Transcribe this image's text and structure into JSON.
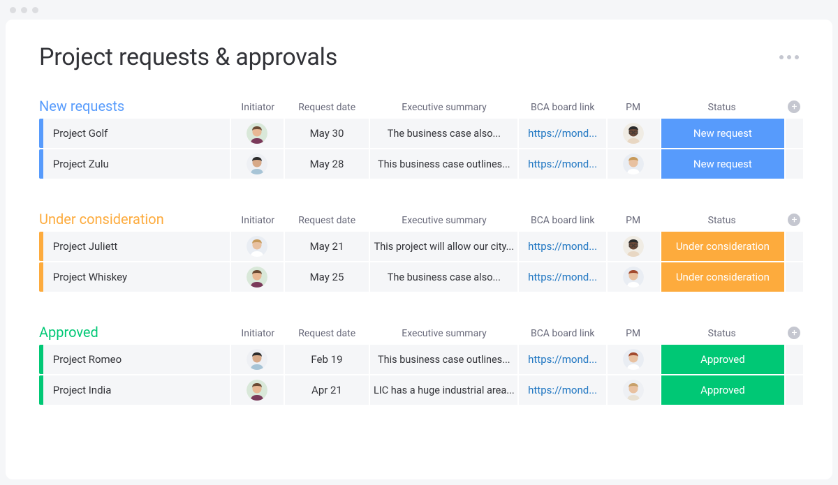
{
  "page_title": "Project requests & approvals",
  "columns": {
    "initiator": "Initiator",
    "request_date": "Request date",
    "summary": "Executive summary",
    "link": "BCA board link",
    "pm": "PM",
    "status": "Status"
  },
  "avatars": {
    "man_beard": {
      "skin": "#e8b894",
      "hair": "#6b4a33",
      "shirt": "#7a3a5a",
      "bg": "#d9e8d9"
    },
    "woman_dark": {
      "skin": "#d7a988",
      "hair": "#2b2b2b",
      "shirt": "#a7c4d6",
      "bg": "#eef0f4"
    },
    "woman_afro": {
      "skin": "#6c4a39",
      "hair": "#2b2b2b",
      "shirt": "#e8d7c3",
      "bg": "#f0ece4",
      "glasses": true
    },
    "woman_blonde": {
      "skin": "#e8c1a1",
      "hair": "#c79a5b",
      "shirt": "#ffffff",
      "bg": "#e9edf3"
    },
    "woman_red": {
      "skin": "#e8c1a1",
      "hair": "#a24a2e",
      "shirt": "#ffffff",
      "bg": "#e9edf3"
    },
    "woman_light": {
      "skin": "#e8c1a1",
      "hair": "#c7a06a",
      "shirt": "#e8e0d2",
      "bg": "#eef0f4"
    }
  },
  "groups": [
    {
      "title": "New requests",
      "accent_class": "accent-blue",
      "title_class": "title-blue",
      "status_class": "status-blue",
      "rows": [
        {
          "name": "Project Golf",
          "initiator_avatar": "man_beard",
          "date": "May 30",
          "summary": "The business case also...",
          "link": "https://mond...",
          "pm_avatar": "woman_afro",
          "status": "New request"
        },
        {
          "name": "Project Zulu",
          "initiator_avatar": "woman_dark",
          "date": "May 28",
          "summary": "This business case outlines...",
          "link": "https://mond...",
          "pm_avatar": "woman_blonde",
          "status": "New request"
        }
      ]
    },
    {
      "title": "Under consideration",
      "accent_class": "accent-orange",
      "title_class": "title-orange",
      "status_class": "status-orange",
      "rows": [
        {
          "name": "Project Juliett",
          "initiator_avatar": "woman_blonde",
          "date": "May 21",
          "summary": "This project will allow our city...",
          "link": "https://mond...",
          "pm_avatar": "woman_afro",
          "status": "Under consideration"
        },
        {
          "name": "Project Whiskey",
          "initiator_avatar": "man_beard",
          "date": "May 25",
          "summary": "The business case also...",
          "link": "https://mond...",
          "pm_avatar": "woman_red",
          "status": "Under consideration"
        }
      ]
    },
    {
      "title": "Approved",
      "accent_class": "accent-green",
      "title_class": "title-green",
      "status_class": "status-green",
      "rows": [
        {
          "name": "Project Romeo",
          "initiator_avatar": "woman_dark",
          "date": "Feb 19",
          "summary": "This business case outlines...",
          "link": "https://mond...",
          "pm_avatar": "woman_red",
          "status": "Approved"
        },
        {
          "name": "Project India",
          "initiator_avatar": "man_beard",
          "date": "Apr 21",
          "summary": "LIC has a huge industrial area...",
          "link": "https://mond...",
          "pm_avatar": "woman_light",
          "status": "Approved"
        }
      ]
    }
  ]
}
